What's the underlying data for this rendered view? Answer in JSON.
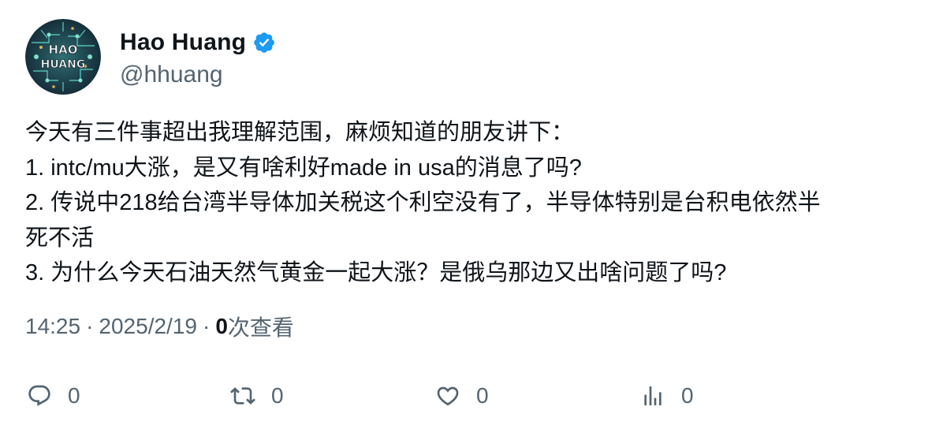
{
  "author": {
    "display_name": "Hao Huang",
    "handle": "@hhuang",
    "avatar_text_line1": "HAO",
    "avatar_text_line2": "HUANG",
    "verified_color": "#1d9bf0"
  },
  "tweet": {
    "lines": [
      "今天有三件事超出我理解范围，麻烦知道的朋友讲下：",
      "1. intc/mu大涨，是又有啥利好made in usa的消息了吗?",
      "2. 传说中218给台湾半导体加关税这个利空没有了，半导体特别是台积电依然半",
      "死不活",
      "3. 为什么今天石油天然气黄金一起大涨？是俄乌那边又出啥问题了吗?"
    ]
  },
  "meta": {
    "time": "14:25",
    "separator": "·",
    "date": "2025/2/19",
    "views_count": "0",
    "views_label": "次查看"
  },
  "actions": {
    "reply_count": "0",
    "retweet_count": "0",
    "like_count": "0",
    "views_count": "0"
  },
  "icons": {
    "reply": "reply-icon",
    "retweet": "retweet-icon",
    "like": "like-icon",
    "views": "views-icon",
    "verified": "verified-badge-icon"
  },
  "colors": {
    "text": "#0f1419",
    "secondary": "#536471",
    "accent": "#1d9bf0"
  }
}
